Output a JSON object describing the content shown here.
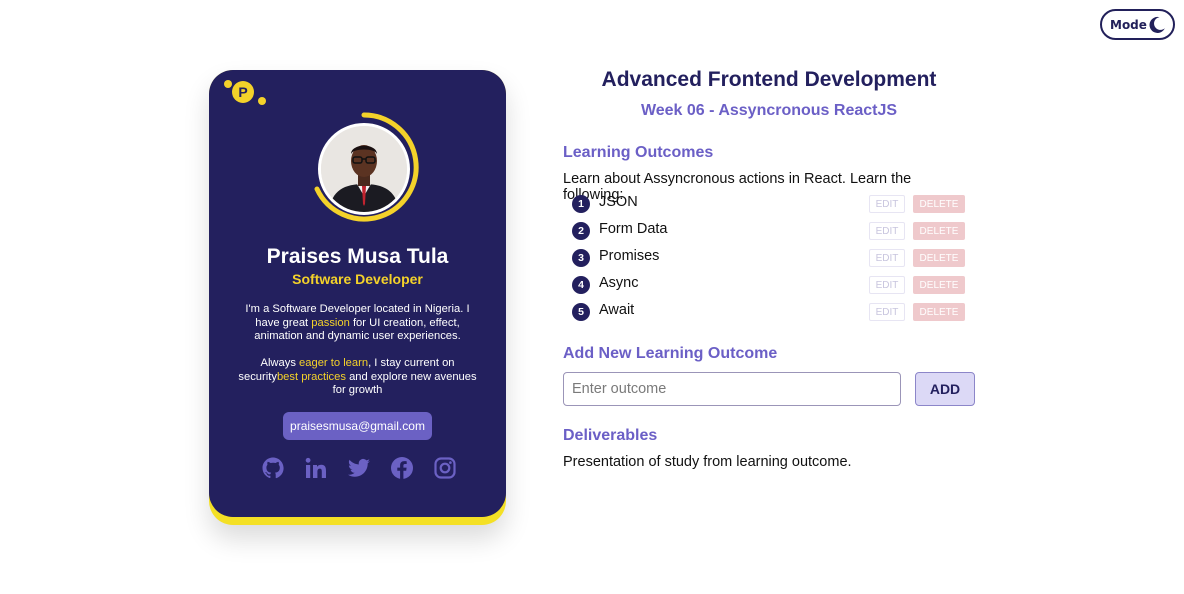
{
  "mode_toggle": {
    "label": "Mode",
    "icon": "moon-icon"
  },
  "colors": {
    "card_bg": "#23205e",
    "accent_yellow": "#f4d22a",
    "accent_purple": "#6b5fc6",
    "email_button": "#6b61c4",
    "delete_button": "#efc9cc",
    "add_button": "#dcd9f6"
  },
  "profile": {
    "logo_letter": "P",
    "name": "Praises Musa Tula",
    "role": "Software Developer",
    "bio1_pre": "I'm a Software Developer located in Nigeria. I have great ",
    "bio1_hl": "passion",
    "bio1_post": " for UI creation, effect, animation and dynamic user experiences.",
    "bio2_pre": "Always ",
    "bio2_hl1": "eager to learn",
    "bio2_mid": ", I stay current on security",
    "bio2_hl2": "best practices",
    "bio2_post": " and explore new avenues for growth",
    "email": "praisesmusa@gmail.com",
    "socials": [
      "github-icon",
      "linkedin-icon",
      "twitter-icon",
      "facebook-icon",
      "instagram-icon"
    ]
  },
  "course": {
    "title": "Advanced Frontend Development",
    "week": "Week 06 - Assyncronous ReactJS"
  },
  "learning_outcomes": {
    "heading": "Learning Outcomes",
    "intro": "Learn about Assyncronous actions in React. Learn the following:",
    "edit_label": "EDIT",
    "delete_label": "DELETE",
    "items": [
      {
        "num": "1",
        "text": "JSON"
      },
      {
        "num": "2",
        "text": "Form Data"
      },
      {
        "num": "3",
        "text": "Promises"
      },
      {
        "num": "4",
        "text": "Async"
      },
      {
        "num": "5",
        "text": "Await"
      }
    ]
  },
  "add_outcome": {
    "heading": "Add New Learning Outcome",
    "placeholder": "Enter outcome",
    "value": "",
    "button": "ADD"
  },
  "deliverables": {
    "heading": "Deliverables",
    "text": "Presentation of study from learning outcome."
  }
}
